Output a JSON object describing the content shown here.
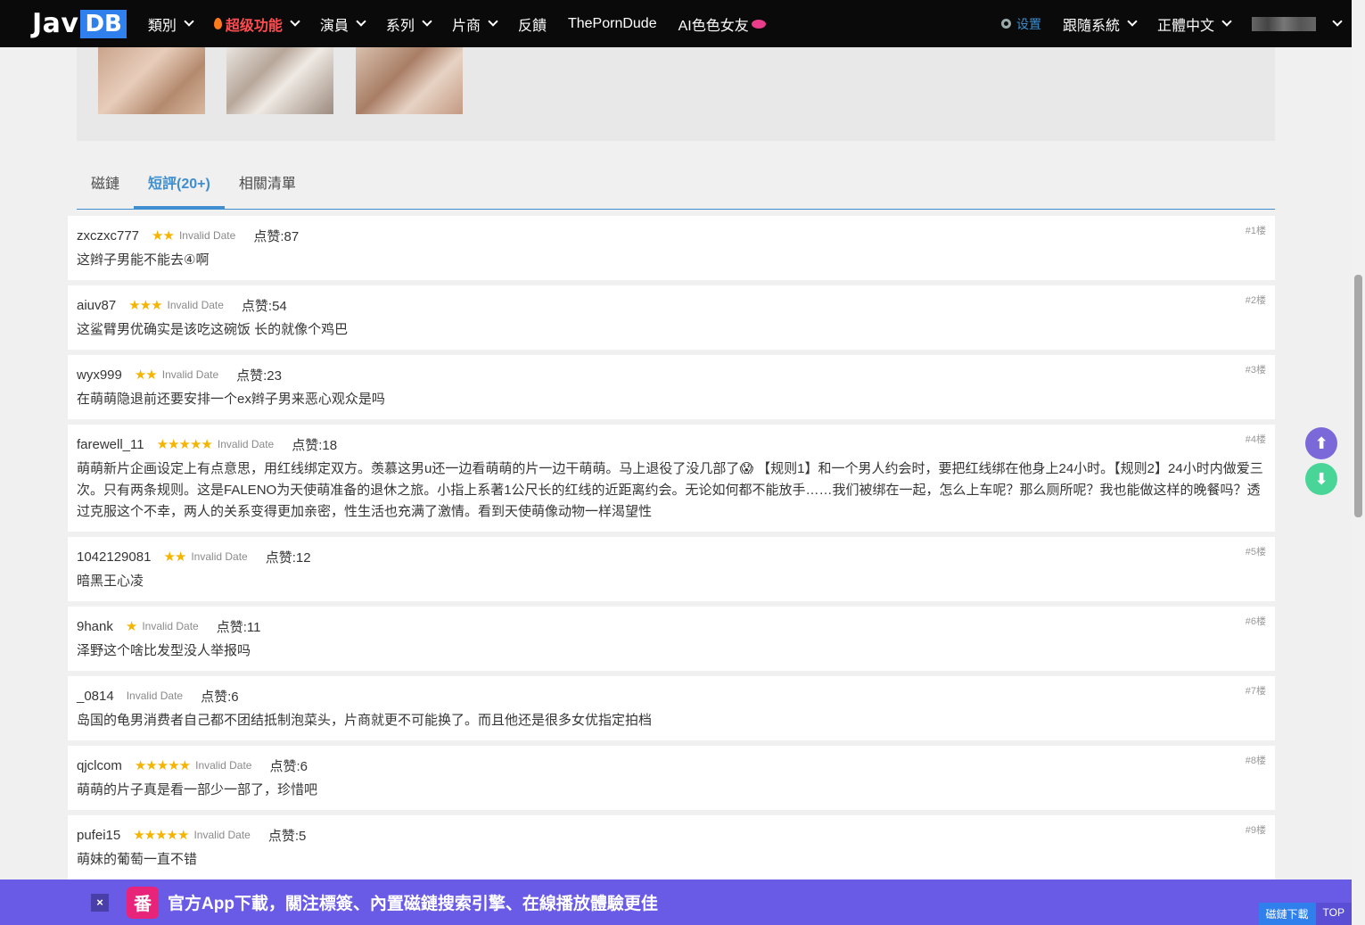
{
  "navbar": {
    "logo_a": "Jav",
    "logo_b": "DB",
    "items": [
      {
        "label": "類別"
      },
      {
        "label": "超级功能"
      },
      {
        "label": "演員"
      },
      {
        "label": "系列"
      },
      {
        "label": "片商"
      },
      {
        "label": "反饋"
      },
      {
        "label": "ThePornDude"
      },
      {
        "label": "AI色色女友"
      }
    ],
    "settings_label": "设置",
    "follow_label": "跟隨系統",
    "lang_label": "正體中文"
  },
  "tabs": [
    {
      "label": "磁鏈"
    },
    {
      "label": "短評(20+)"
    },
    {
      "label": "相關清單"
    }
  ],
  "reviews": [
    {
      "user": "zxczxc777",
      "stars": 2,
      "date": "Invalid Date",
      "likes": "点赞:87",
      "floor": "#1楼",
      "content": "这辫子男能不能去④啊"
    },
    {
      "user": "aiuv87",
      "stars": 3,
      "date": "Invalid Date",
      "likes": "点赞:54",
      "floor": "#2楼",
      "content": "这鲨臂男优确实是该吃这碗饭 长的就像个鸡巴"
    },
    {
      "user": "wyx999",
      "stars": 2,
      "date": "Invalid Date",
      "likes": "点赞:23",
      "floor": "#3楼",
      "content": "在萌萌隐退前还要安排一个ex辫子男来恶心观众是吗"
    },
    {
      "user": "farewell_11",
      "stars": 5,
      "date": "Invalid Date",
      "likes": "点赞:18",
      "floor": "#4楼",
      "content": "萌萌新片企画设定上有点意思，用红线绑定双方。羡慕这男u还一边看萌萌的片一边干萌萌。马上退役了没几部了😱 【规则1】和一个男人约会时，要把红线绑在他身上24小时。【规则2】24小时内做爱三次。只有两条规则。这是FALENO为天使萌准备的退休之旅。小指上系著1公尺长的红线的近距离约会。无论如何都不能放手……我们被绑在一起，怎么上车呢？那么厕所呢？我也能做这样的晚餐吗？透过克服这个不幸，两人的关系变得更加亲密，性生活也充满了激情。看到天使萌像动物一样渴望性"
    },
    {
      "user": "1042129081",
      "stars": 2,
      "date": "Invalid Date",
      "likes": "点赞:12",
      "floor": "#5楼",
      "content": "暗黑王心凌"
    },
    {
      "user": "9hank",
      "stars": 1,
      "date": "Invalid Date",
      "likes": "点赞:11",
      "floor": "#6楼",
      "content": "泽野这个啥比发型没人举报吗"
    },
    {
      "user": "_0814",
      "stars": 0,
      "date": "Invalid Date",
      "likes": "点赞:6",
      "floor": "#7楼",
      "content": "岛国的龟男消费者自己都不团结抵制泡菜头，片商就更不可能换了。而且他还是很多女优指定拍档"
    },
    {
      "user": "qjclcom",
      "stars": 5,
      "date": "Invalid Date",
      "likes": "点赞:6",
      "floor": "#8楼",
      "content": "萌萌的片子真是看一部少一部了，珍惜吧"
    },
    {
      "user": "pufei15",
      "stars": 5,
      "date": "Invalid Date",
      "likes": "点赞:5",
      "floor": "#9楼",
      "content": "萌妹的葡萄一直不错"
    }
  ],
  "banner": {
    "close": "×",
    "app_icon": "番",
    "text": "官方App下載，關注標簽、內置磁鏈搜索引擎、在線播放體驗更佳",
    "magnet_download": "磁鏈下載",
    "top": "TOP"
  },
  "colors": {
    "accent": "#3e8ed0",
    "star": "#f5b400",
    "banner": "#6a5be6",
    "hot": "#ff4d4f"
  }
}
